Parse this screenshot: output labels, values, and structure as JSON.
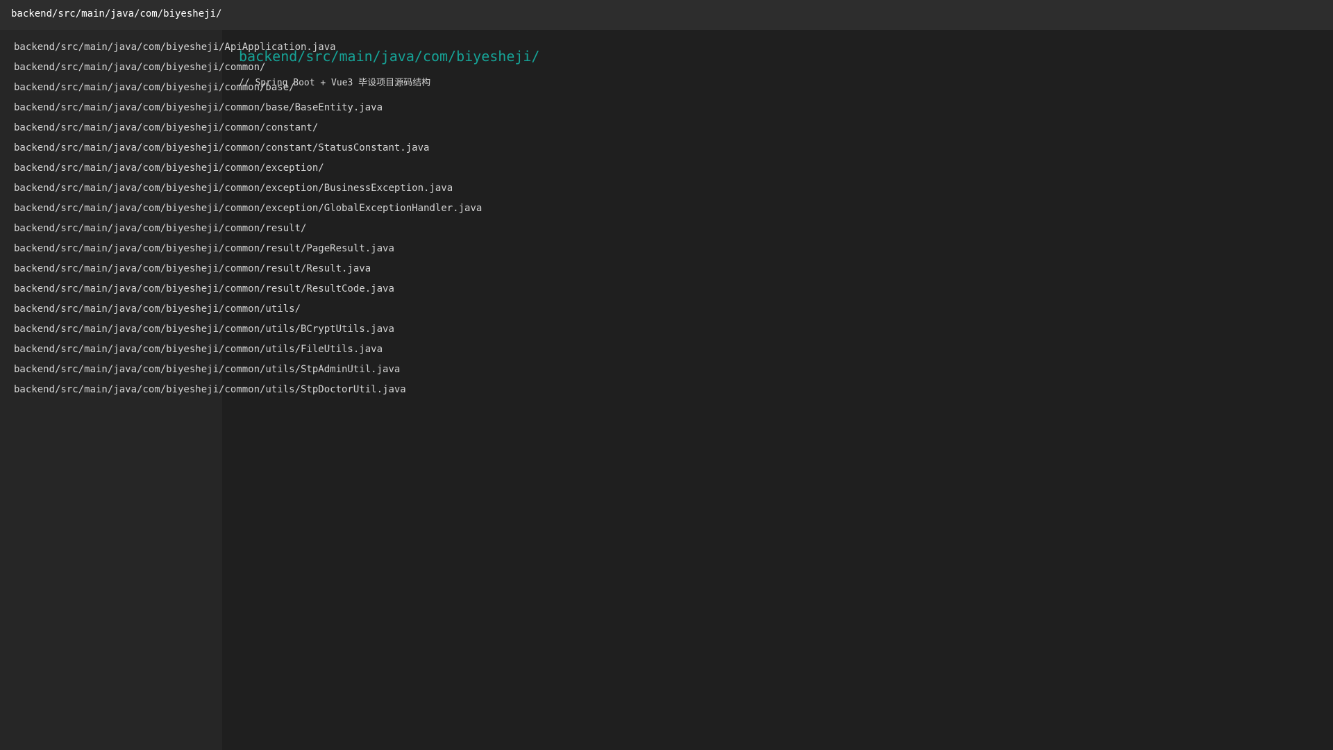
{
  "window": {
    "title": "backend/src/main/java/com/biyesheji/"
  },
  "main": {
    "title": "backend/src/main/java/com/biyesheji/",
    "subtitle": "// Spring Boot + Vue3 毕设项目源码结构"
  },
  "sidebar": {
    "items": [
      "backend/src/main/java/com/biyesheji/ApiApplication.java",
      "backend/src/main/java/com/biyesheji/common/",
      "backend/src/main/java/com/biyesheji/common/base/",
      "backend/src/main/java/com/biyesheji/common/base/BaseEntity.java",
      "backend/src/main/java/com/biyesheji/common/constant/",
      "backend/src/main/java/com/biyesheji/common/constant/StatusConstant.java",
      "backend/src/main/java/com/biyesheji/common/exception/",
      "backend/src/main/java/com/biyesheji/common/exception/BusinessException.java",
      "backend/src/main/java/com/biyesheji/common/exception/GlobalExceptionHandler.java",
      "backend/src/main/java/com/biyesheji/common/result/",
      "backend/src/main/java/com/biyesheji/common/result/PageResult.java",
      "backend/src/main/java/com/biyesheji/common/result/Result.java",
      "backend/src/main/java/com/biyesheji/common/result/ResultCode.java",
      "backend/src/main/java/com/biyesheji/common/utils/",
      "backend/src/main/java/com/biyesheji/common/utils/BCryptUtils.java",
      "backend/src/main/java/com/biyesheji/common/utils/FileUtils.java",
      "backend/src/main/java/com/biyesheji/common/utils/StpAdminUtil.java",
      "backend/src/main/java/com/biyesheji/common/utils/StpDoctorUtil.java"
    ]
  }
}
